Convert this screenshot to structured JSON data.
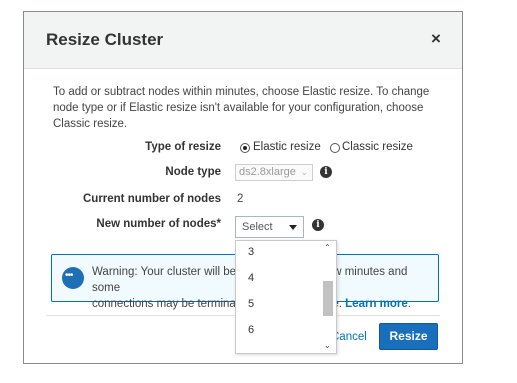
{
  "dialog": {
    "title": "Resize Cluster",
    "close_label": "×",
    "description": "To add or subtract nodes within minutes, choose Elastic resize. To change node type or if Elastic resize isn't available for your configuration, choose Classic resize."
  },
  "form": {
    "type_of_resize_label": "Type of resize",
    "elastic_option": "Elastic resize",
    "classic_option": "Classic resize",
    "selected_resize": "elastic",
    "node_type_label": "Node type",
    "node_type_value": "ds2.8xlarge",
    "current_nodes_label": "Current number of nodes",
    "current_nodes_value": "2",
    "new_nodes_label": "New number of nodes*",
    "new_nodes_placeholder": "Select",
    "dropdown_options": [
      "3",
      "4",
      "5",
      "6"
    ]
  },
  "warning": {
    "text_before": "Warning: Your cluster will be",
    "text_after": "a few minutes and some",
    "line2_before": "connections may be terminat",
    "line2_after": "time.",
    "link": "Learn more",
    "suffix": "."
  },
  "footer": {
    "cancel_label": "Cancel",
    "resize_label": "Resize"
  },
  "colors": {
    "primary": "#1a6fbd",
    "link": "#0073bb",
    "warning_bg": "#f1faff"
  }
}
